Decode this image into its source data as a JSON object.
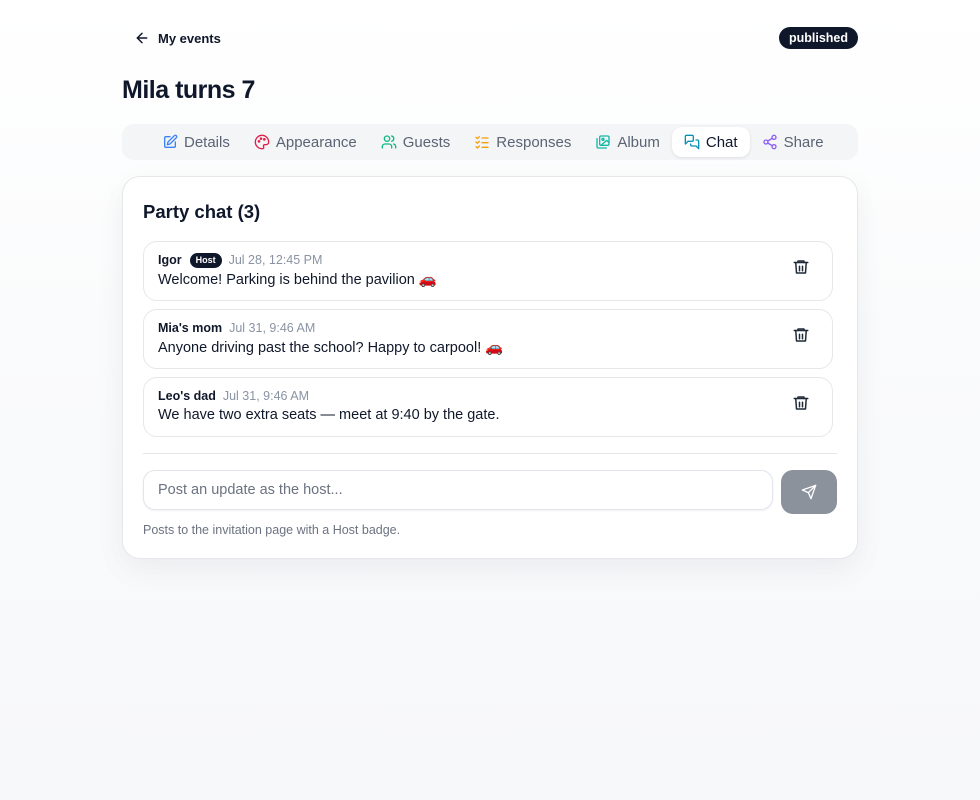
{
  "header": {
    "back_label": "My events",
    "status": "published"
  },
  "event": {
    "title": "Mila turns 7"
  },
  "tabs": [
    {
      "label": "Details",
      "icon": "edit-icon",
      "color": "#3b82f6"
    },
    {
      "label": "Appearance",
      "icon": "palette-icon",
      "color": "#e11d48"
    },
    {
      "label": "Guests",
      "icon": "users-icon",
      "color": "#10b981"
    },
    {
      "label": "Responses",
      "icon": "list-checks-icon",
      "color": "#f59e0b"
    },
    {
      "label": "Album",
      "icon": "images-icon",
      "color": "#14b8a6"
    },
    {
      "label": "Chat",
      "icon": "chat-icon",
      "color": "#0891b2",
      "active": true
    },
    {
      "label": "Share",
      "icon": "share-icon",
      "color": "#8b5cf6"
    }
  ],
  "chat": {
    "title": "Party chat (3)",
    "messages": [
      {
        "author": "Igor",
        "badge": "Host",
        "time": "Jul 28, 12:45 PM",
        "text": "Welcome! Parking is behind the pavilion 🚗"
      },
      {
        "author": "Mia's mom",
        "time": "Jul 31, 9:46 AM",
        "text": "Anyone driving past the school? Happy to carpool! 🚗"
      },
      {
        "author": "Leo's dad",
        "time": "Jul 31, 9:46 AM",
        "text": "We have two extra seats — meet at 9:40 by the gate."
      }
    ],
    "compose_placeholder": "Post an update as the host...",
    "hint": "Posts to the invitation page with a Host badge."
  }
}
